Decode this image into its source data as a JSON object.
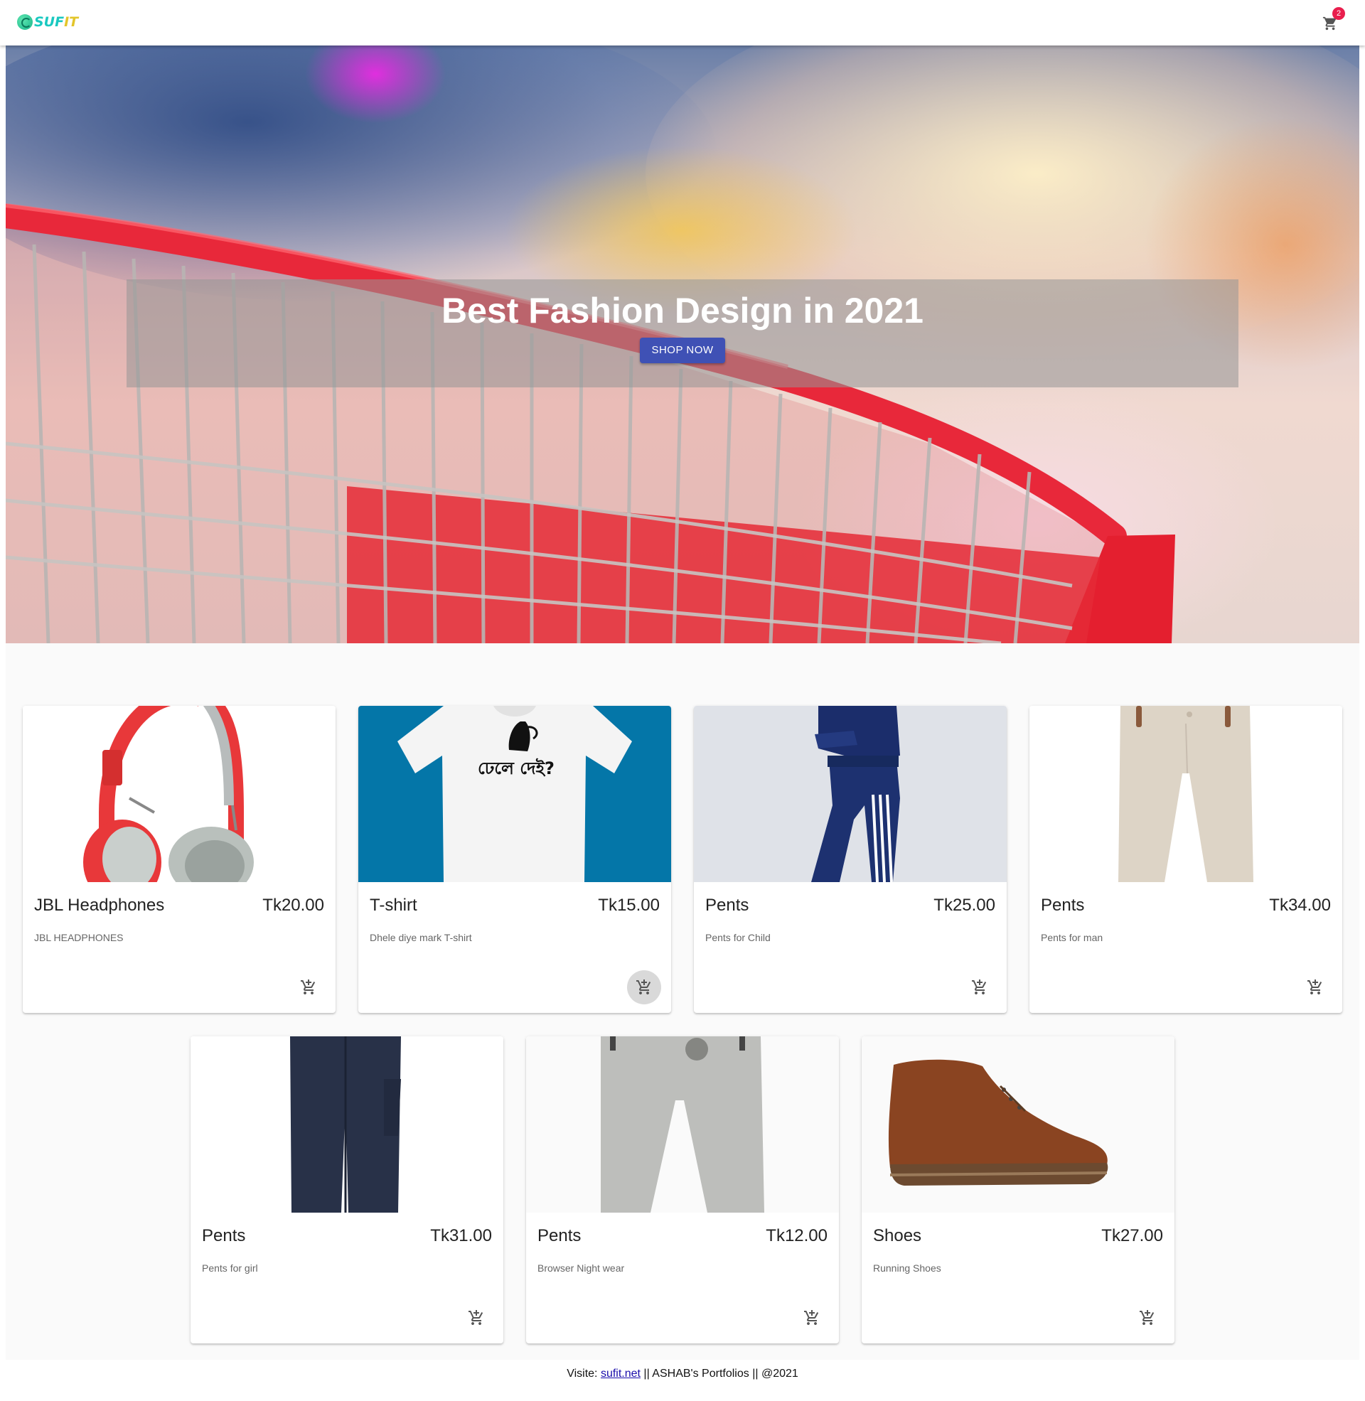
{
  "brand": {
    "logo_part1": "SUF",
    "logo_part2": "IT"
  },
  "header": {
    "cart_count": "2"
  },
  "hero": {
    "title": "Best Fashion Design in 2021",
    "cta": "SHOP NOW"
  },
  "products": [
    {
      "name": "JBL Headphones",
      "price": "Tk20.00",
      "description": "JBL HEADPHONES"
    },
    {
      "name": "T-shirt",
      "price": "Tk15.00",
      "description": "Dhele diye mark T-shirt",
      "print_text": "ঢেলে দেই?"
    },
    {
      "name": "Pents",
      "price": "Tk25.00",
      "description": "Pents for Child"
    },
    {
      "name": "Pents",
      "price": "Tk34.00",
      "description": "Pents for man"
    },
    {
      "name": "Pents",
      "price": "Tk31.00",
      "description": "Pents for girl"
    },
    {
      "name": "Pents",
      "price": "Tk12.00",
      "description": "Browser Night wear"
    },
    {
      "name": "Shoes",
      "price": "Tk27.00",
      "description": "Running Shoes"
    }
  ],
  "footer": {
    "prefix": "Visite: ",
    "link": "sufit.net",
    "suffix": " || ASHAB's Portfolios || @2021"
  },
  "colors": {
    "primary": "#3f51b5",
    "badge": "#e91e4d",
    "tshirt_bg": "#0476a8"
  }
}
